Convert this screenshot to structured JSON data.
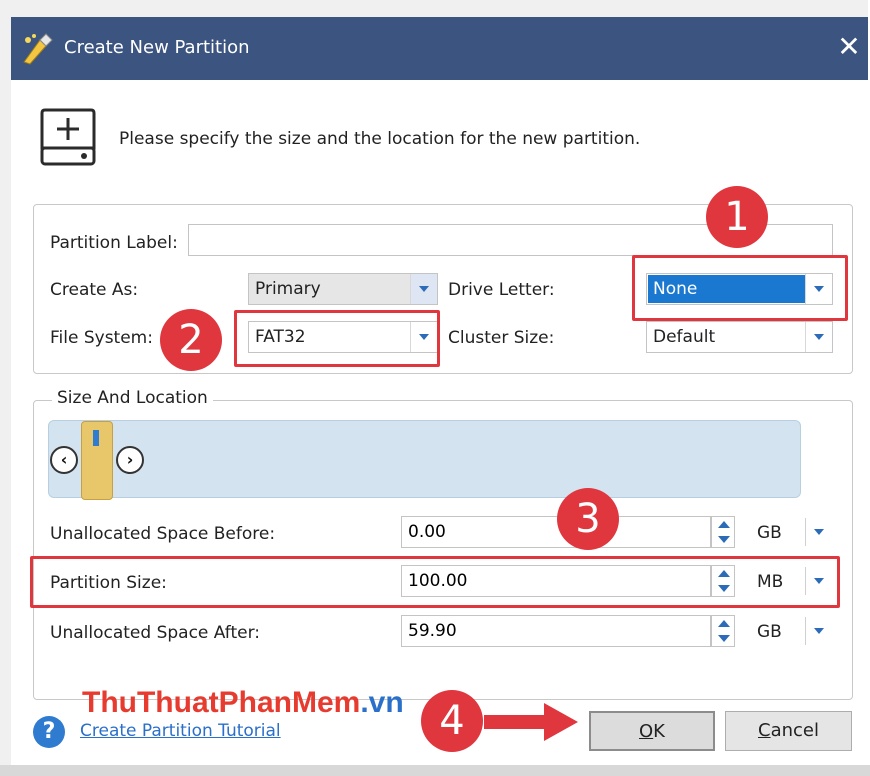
{
  "window": {
    "title": "Create New Partition",
    "close_glyph": "✕"
  },
  "intro": {
    "text": "Please specify the size and the location for the new partition."
  },
  "form": {
    "partition_label": {
      "label": "Partition Label:",
      "value": ""
    },
    "create_as": {
      "label": "Create As:",
      "value": "Primary"
    },
    "drive_letter": {
      "label": "Drive Letter:",
      "value": "None"
    },
    "file_system": {
      "label": "File System:",
      "value": "FAT32"
    },
    "cluster_size": {
      "label": "Cluster Size:",
      "value": "Default"
    }
  },
  "size_location": {
    "title": "Size And Location",
    "nav_left": "‹",
    "nav_right": "›",
    "rows": [
      {
        "label": "Unallocated Space Before:",
        "value": "0.00",
        "unit": "GB"
      },
      {
        "label": "Partition Size:",
        "value": "100.00",
        "unit": "MB"
      },
      {
        "label": "Unallocated Space After:",
        "value": "59.90",
        "unit": "GB"
      }
    ]
  },
  "annotations": {
    "badge1": "1",
    "badge2": "2",
    "badge3": "3",
    "badge4": "4",
    "color": "#e0363e"
  },
  "watermark": {
    "main": "ThuThuatPhanMem",
    "tail": ".vn"
  },
  "footer": {
    "help_glyph": "?",
    "help_link": "Create Partition Tutorial",
    "ok_key": "O",
    "ok_rest": "K",
    "cancel_key": "C",
    "cancel_rest": "ancel"
  },
  "icons": {
    "app": "partition-wizard-icon",
    "drive": "new-drive-icon",
    "help": "help-icon"
  },
  "colors": {
    "titlebar": "#3c5480",
    "accent": "#2c6bb8",
    "selection": "#1b78d0",
    "slider_block": "#e8c66a"
  }
}
